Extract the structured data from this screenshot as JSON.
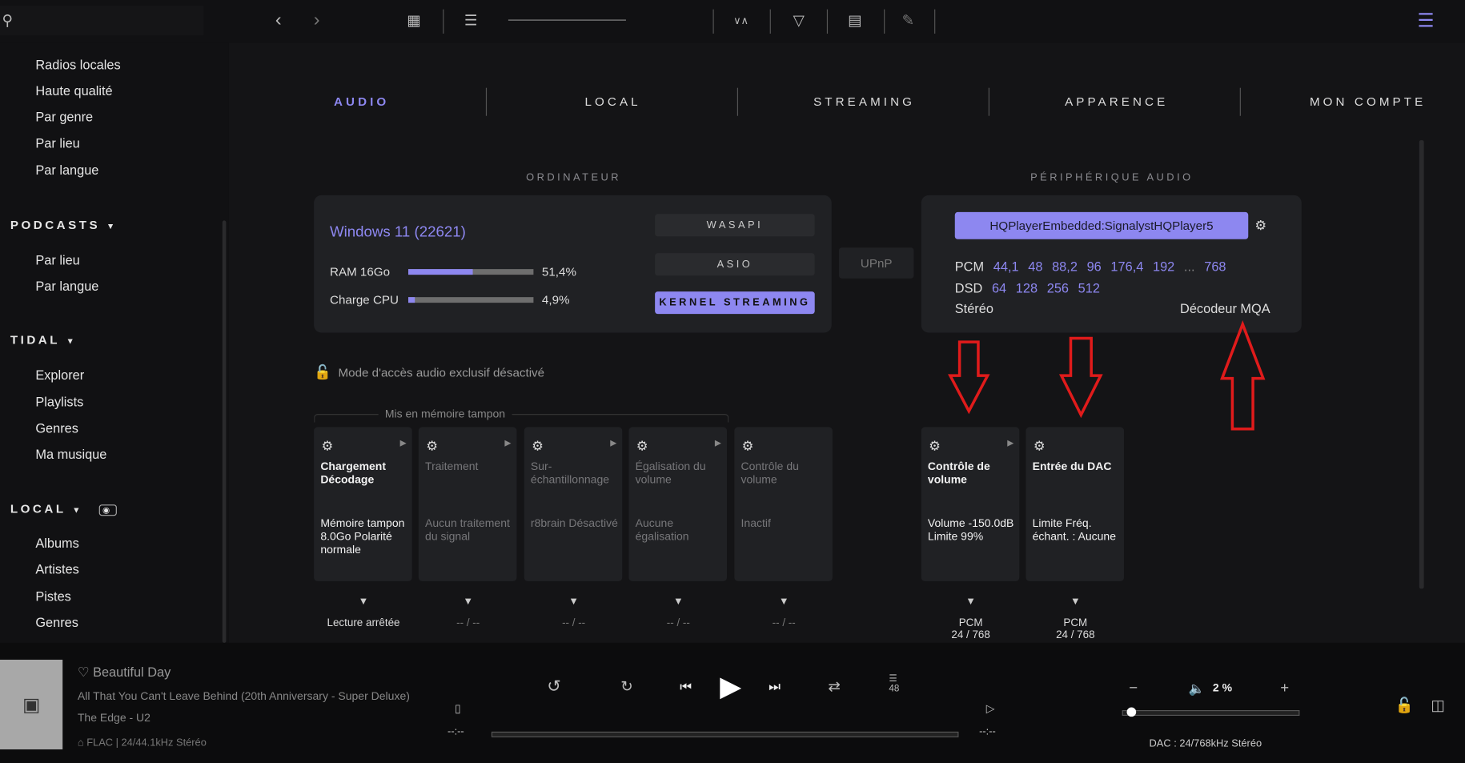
{
  "sidebar": {
    "items_top": [
      "Radios locales",
      "Haute qualité",
      "Par genre",
      "Par lieu",
      "Par langue"
    ],
    "podcasts": {
      "label": "PODCASTS",
      "items": [
        "Par lieu",
        "Par langue"
      ]
    },
    "tidal": {
      "label": "TIDAL",
      "items": [
        "Explorer",
        "Playlists",
        "Genres",
        "Ma musique"
      ]
    },
    "local": {
      "label": "LOCAL",
      "items": [
        "Albums",
        "Artistes",
        "Pistes",
        "Genres"
      ]
    }
  },
  "tabs": [
    "AUDIO",
    "LOCAL",
    "STREAMING",
    "APPARENCE",
    "MON COMPTE"
  ],
  "computer": {
    "section": "ORDINATEUR",
    "os": "Windows 11 (22621)",
    "ram_label": "RAM 16Go",
    "ram_value": "51,4%",
    "ram_fraction": 0.514,
    "cpu_label": "Charge CPU",
    "cpu_value": "4,9%",
    "cpu_fraction": 0.049,
    "modes": [
      "WASAPI",
      "ASIO",
      "KERNEL STREAMING"
    ],
    "upnp": "UPnP"
  },
  "device": {
    "section": "PÉRIPHÉRIQUE AUDIO",
    "name": "HQPlayerEmbedded:SignalystHQPlayer5",
    "pcm_label": "PCM",
    "pcm_rates": [
      "44,1",
      "48",
      "88,2",
      "96",
      "176,4",
      "192",
      "...",
      "768"
    ],
    "dsd_label": "DSD",
    "dsd_rates": [
      "64",
      "128",
      "256",
      "512"
    ],
    "channels": "Stéréo",
    "mqa": "Décodeur MQA"
  },
  "exclusive": "Mode d'accès audio exclusif désactivé",
  "buffer_label": "Mis en mémoire tampon",
  "pipeline": [
    {
      "title": "Chargement Décodage",
      "detail": "Mémoire tampon 8.0Go Polarité normale",
      "status": "Lecture arrêtée",
      "active": true
    },
    {
      "title": "Traitement",
      "detail": "Aucun traitement du signal",
      "status": "-- / --",
      "active": false
    },
    {
      "title": "Sur-échantillonnage",
      "detail": "r8brain Désactivé",
      "status": "-- / --",
      "active": false
    },
    {
      "title": "Égalisation du volume",
      "detail": "Aucune égalisation",
      "status": "-- / --",
      "active": false
    },
    {
      "title": "Contrôle du volume",
      "detail": "Inactif",
      "status": "-- / --",
      "active": false
    },
    {
      "title": "Contrôle de volume",
      "detail": "Volume -150.0dB Limite 99%",
      "status": "PCM\n24 / 768",
      "active": true
    },
    {
      "title": "Entrée du DAC",
      "detail": "Limite Fréq. échant. : Aucune",
      "status": "PCM\n24 / 768",
      "active": true
    }
  ],
  "player": {
    "title": "Beautiful Day",
    "album": "All That You Can't Leave Behind (20th Anniversary - Super Deluxe)",
    "artist": "The Edge - U2",
    "format": "FLAC | 24/44.1kHz Stéréo",
    "time_left": "--:--",
    "time_right": "--:--",
    "queue_count": "48",
    "volume": "2 %",
    "volume_fraction": 0.02,
    "dac": "DAC : 24/768kHz Stéréo"
  },
  "colors": {
    "accent": "#8d87f0",
    "annotation": "#e01b1b"
  }
}
